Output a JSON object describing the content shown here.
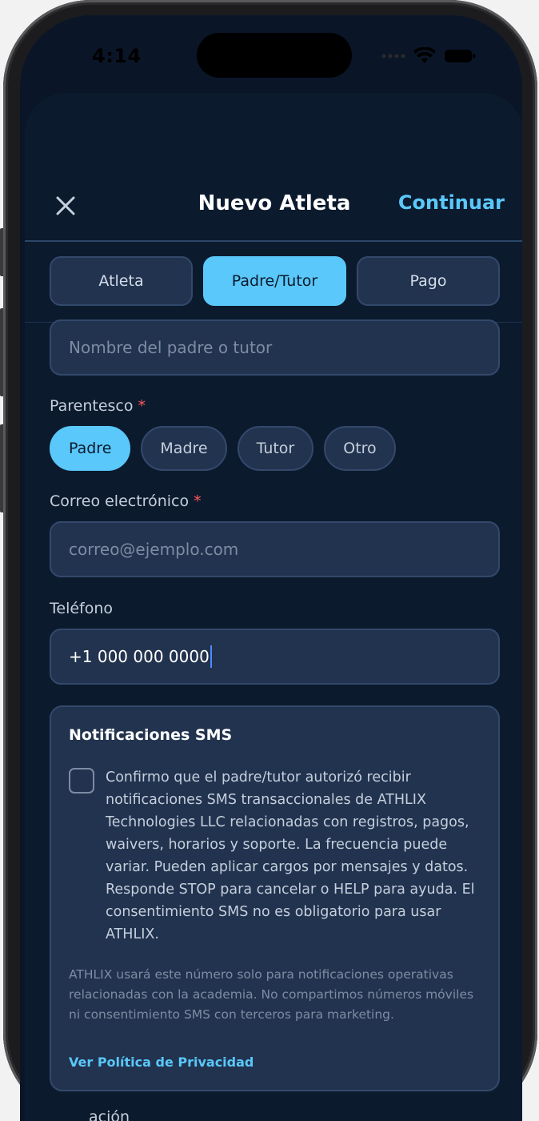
{
  "status": {
    "time": "4:14"
  },
  "header": {
    "title": "Nuevo Atleta",
    "continue_label": "Continuar"
  },
  "tabs": [
    {
      "label": "Atleta",
      "active": false
    },
    {
      "label": "Padre/Tutor",
      "active": true
    },
    {
      "label": "Pago",
      "active": false
    }
  ],
  "guardian_name": {
    "placeholder": "Nombre del padre o tutor"
  },
  "relationship": {
    "label": "Parentesco",
    "required_mark": "*",
    "options": [
      "Padre",
      "Madre",
      "Tutor",
      "Otro"
    ],
    "selected": "Padre"
  },
  "email": {
    "label": "Correo electrónico",
    "required_mark": "*",
    "placeholder": "correo@ejemplo.com"
  },
  "phone": {
    "label": "Teléfono",
    "value": "+1 000 000 0000"
  },
  "sms": {
    "title": "Notificaciones SMS",
    "consent_text": "Confirmo que el padre/tutor autorizó recibir notificaciones SMS transaccionales de ATHLIX Technologies LLC relacionadas con registros, pagos, waivers, horarios y soporte. La frecuencia puede variar. Pueden aplicar cargos por mensajes y datos. Responde STOP para cancelar o HELP para ayuda. El consentimiento SMS no es obligatorio para usar ATHLIX.",
    "note": "ATHLIX usará este número solo para notificaciones operativas relacionadas con la academia. No compartimos números móviles ni consentimiento SMS con terceros para marketing.",
    "privacy_link": "Ver Política de Privacidad"
  },
  "next_section_partial": "ación",
  "colors": {
    "accent": "#5ac8fa",
    "background": "#0c1a2e",
    "field": "#22334f",
    "required": "#ff5a5a"
  }
}
